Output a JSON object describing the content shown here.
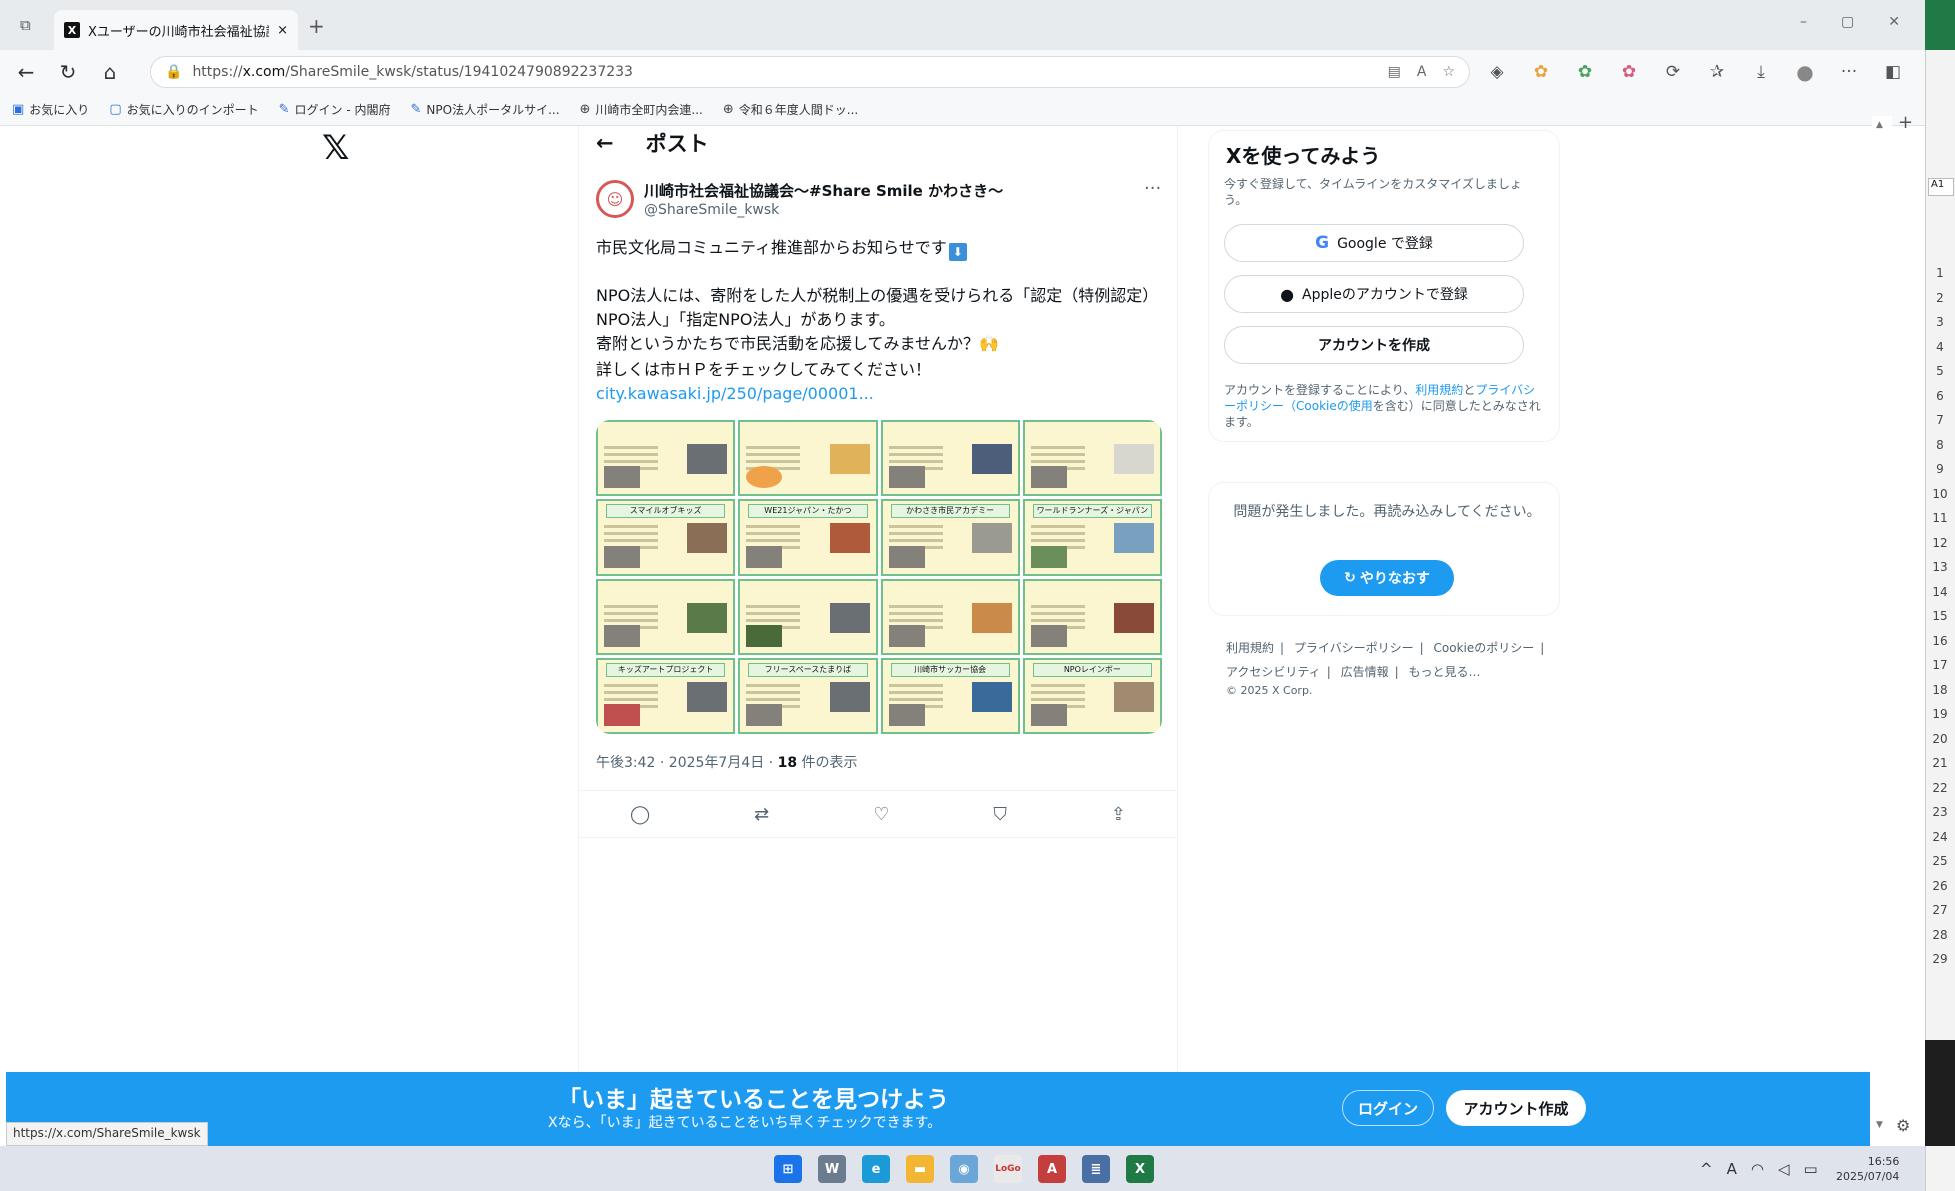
{
  "browser": {
    "tab_title": "Xユーザーの川崎市社会福祉協議会",
    "tab_close": "×",
    "new_tab": "+",
    "url_prefix": "https://",
    "url_domain": "x.com",
    "url_path": "/ShareSmile_kwsk/status/1941024790892237233",
    "bookmarks": [
      {
        "label": "お気に入り"
      },
      {
        "label": "お気に入りのインポート"
      },
      {
        "label": "ログイン - 内閣府"
      },
      {
        "label": "NPO法人ポータルサイ..."
      },
      {
        "label": "川崎市全町内会連..."
      },
      {
        "label": "令和６年度人間ドッ..."
      }
    ],
    "status_url": "https://x.com/ShareSmile_kwsk"
  },
  "post": {
    "header_title": "ポスト",
    "back_arrow": "←",
    "author_name": "川崎市社会福祉協議会〜#Share Smile かわさき〜",
    "author_handle": "@ShareSmile_kwsk",
    "more": "···",
    "line1": "市民文化局コミュニティ推進部からお知らせです",
    "line2": "NPO法人には、寄附をした人が税制上の優遇を受けられる「認定（特例認定）NPO法人」「指定NPO法人」があります。",
    "line3": "寄附というかたちで市民活動を応援してみませんか？🙌",
    "line4": "詳しくは市ＨＰをチェックしてみてください！",
    "link": "city.kawasaki.jp/250/page/00001...",
    "timestamp": "午後3:42 · 2025年7月4日 · ",
    "views_count": "18",
    "views_label": " 件の表示",
    "image_banners": [
      "",
      "",
      "",
      "",
      "スマイルオブキッズ",
      "WE21ジャパン・たかつ",
      "かわさき市民アカデミー",
      "ワールドランナーズ・ジャパン",
      "",
      "",
      "",
      "",
      "キッズアートプロジェクト",
      "フリースペースたまりば",
      "川崎市サッカー協会",
      "NPOレインボー"
    ]
  },
  "sidebar": {
    "title": "Xを使ってみよう",
    "subtitle": "今すぐ登録して、タイムラインをカスタマイズしましょう。",
    "google_btn": "Google で登録",
    "apple_btn": "Appleのアカウントで登録",
    "create_btn": "アカウントを作成",
    "terms_a": "アカウントを登録することにより、",
    "terms_link1": "利用規約",
    "terms_b": "と",
    "terms_link2": "プライバシーポリシー（Cookieの使用",
    "terms_c": "を含む）に同意したとみなされます。",
    "error_text": "問題が発生しました。再読み込みしてください。",
    "retry_btn": "やりなおす",
    "footer_links": [
      "利用規約",
      "|",
      "プライバシーポリシー",
      "|",
      "Cookieのポリシー",
      "|",
      "アクセシビリティ",
      "|",
      "広告情報",
      "|",
      "もっと見る…"
    ],
    "copyright": "© 2025 X Corp."
  },
  "banner": {
    "headline": "「いま」起きていることを見つけよう",
    "sub": "Xなら、「いま」起きていることをいち早くチェックできます。",
    "login": "ログイン",
    "create": "アカウント作成"
  },
  "taskbar": {
    "time": "16:56",
    "date": "2025/07/04"
  },
  "excel": {
    "cell_ref": "A1",
    "rows": [
      "1",
      "2",
      "3",
      "4",
      "5",
      "6",
      "7",
      "8",
      "9",
      "10",
      "11",
      "12",
      "13",
      "14",
      "15",
      "16",
      "17",
      "18",
      "19",
      "20",
      "21",
      "22",
      "23",
      "24",
      "25",
      "26",
      "27",
      "28",
      "29"
    ]
  }
}
